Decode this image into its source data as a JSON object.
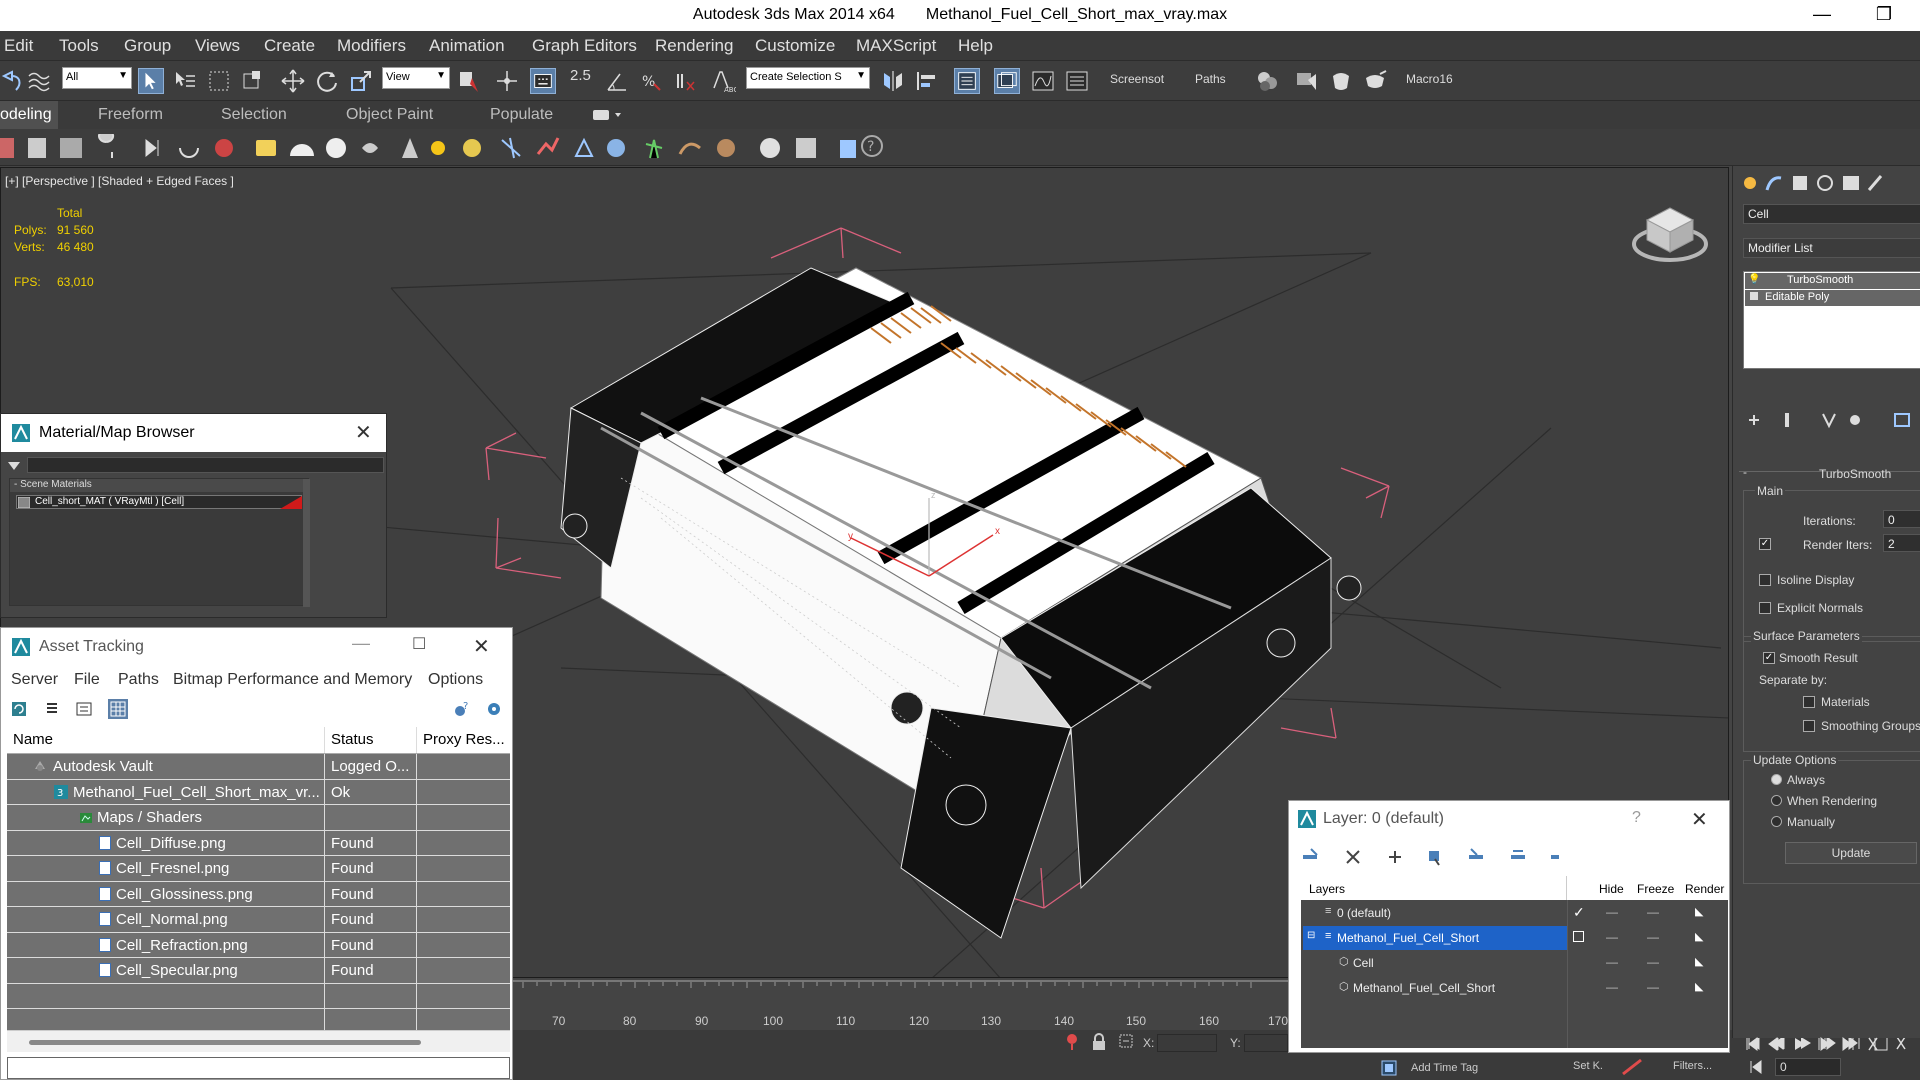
{
  "window": {
    "app_title": "Autodesk 3ds Max  2014 x64",
    "file_title": "Methanol_Fuel_Cell_Short_max_vray.max",
    "minimize_glyph": "—",
    "maximize_glyph": "❐"
  },
  "menu": [
    "Edit",
    "Tools",
    "Group",
    "Views",
    "Create",
    "Modifiers",
    "Animation",
    "Graph Editors",
    "Rendering",
    "Customize",
    "MAXScript",
    "Help"
  ],
  "toolbar": {
    "filter_value": "All",
    "refcoord_value": "View",
    "snap_label": "2.5",
    "selection_set_placeholder": "Create Selection S",
    "screenshot_label": "Screensot",
    "paths_label": "Paths",
    "macro_label": "Macro16"
  },
  "ribbon_tabs": [
    "odeling",
    "Freeform",
    "Selection",
    "Object Paint",
    "Populate"
  ],
  "viewport": {
    "label": "[+] [Perspective ] [Shaded + Edged Faces ]",
    "stats_total": "Total",
    "polys_label": "Polys:",
    "polys_value": "91 560",
    "verts_label": "Verts:",
    "verts_value": "46 480",
    "fps_label": "FPS:",
    "fps_value": "63,010",
    "axis_x": "x",
    "axis_y": "y",
    "axis_z": "z"
  },
  "material_browser": {
    "title": "Material/Map Browser",
    "section": "- Scene Materials",
    "item": "Cell_short_MAT ( VRayMtl ) [Cell]"
  },
  "asset_tracking": {
    "title": "Asset Tracking",
    "menu": [
      "Server",
      "File",
      "Paths",
      "Bitmap Performance and Memory",
      "Options"
    ],
    "columns": [
      "Name",
      "Status",
      "Proxy Res..."
    ],
    "rows": [
      {
        "name": "Autodesk Vault",
        "status": "Logged O...",
        "indent": 0
      },
      {
        "name": "Methanol_Fuel_Cell_Short_max_vr...",
        "status": "Ok",
        "indent": 1
      },
      {
        "name": "Maps / Shaders",
        "status": "",
        "indent": 2
      },
      {
        "name": "Cell_Diffuse.png",
        "status": "Found",
        "indent": 3
      },
      {
        "name": "Cell_Fresnel.png",
        "status": "Found",
        "indent": 3
      },
      {
        "name": "Cell_Glossiness.png",
        "status": "Found",
        "indent": 3
      },
      {
        "name": "Cell_Normal.png",
        "status": "Found",
        "indent": 3
      },
      {
        "name": "Cell_Refraction.png",
        "status": "Found",
        "indent": 3
      },
      {
        "name": "Cell_Specular.png",
        "status": "Found",
        "indent": 3
      }
    ]
  },
  "layer_dialog": {
    "title": "Layer: 0 (default)",
    "help": "?",
    "columns": [
      "Layers",
      "Hide",
      "Freeze",
      "Render"
    ],
    "rows": [
      {
        "name": "0 (default)",
        "indent": 0,
        "selected": false
      },
      {
        "name": "Methanol_Fuel_Cell_Short",
        "indent": 0,
        "selected": true
      },
      {
        "name": "Cell",
        "indent": 1,
        "selected": false
      },
      {
        "name": "Methanol_Fuel_Cell_Short",
        "indent": 1,
        "selected": false
      }
    ],
    "checkmark": "✓"
  },
  "command_panel": {
    "object_name": "Cell",
    "modifier_list": "Modifier List",
    "stack": [
      "TurboSmooth",
      "Editable Poly"
    ],
    "rollout_title": "TurboSmooth",
    "main_group": "Main",
    "iterations_label": "Iterations:",
    "iterations_value": "0",
    "render_iters_label": "Render Iters:",
    "render_iters_value": "2",
    "isoline_label": "Isoline Display",
    "explicit_label": "Explicit Normals",
    "surface_group": "Surface Parameters",
    "smooth_result_label": "Smooth Result",
    "separate_by_label": "Separate by:",
    "materials_label": "Materials",
    "smoothing_groups_label": "Smoothing Groups",
    "update_group": "Update Options",
    "always_label": "Always",
    "when_rendering_label": "When Rendering",
    "manually_label": "Manually",
    "update_button": "Update"
  },
  "timeline": {
    "ticks": [
      "70",
      "80",
      "90",
      "100",
      "110",
      "120",
      "130",
      "140",
      "150",
      "160",
      "170"
    ],
    "x_label": "X:",
    "y_label": "Y:"
  },
  "status": {
    "add_time_tag": "Add Time Tag",
    "set_key": "Set K.",
    "filters": "Filters...",
    "frame_value": "0"
  },
  "colors": {
    "accent": "#5b7fa8",
    "selected_layer": "#1e63c8",
    "stats_yellow": "#f0d000",
    "bbox_pink": "#d9607c"
  }
}
